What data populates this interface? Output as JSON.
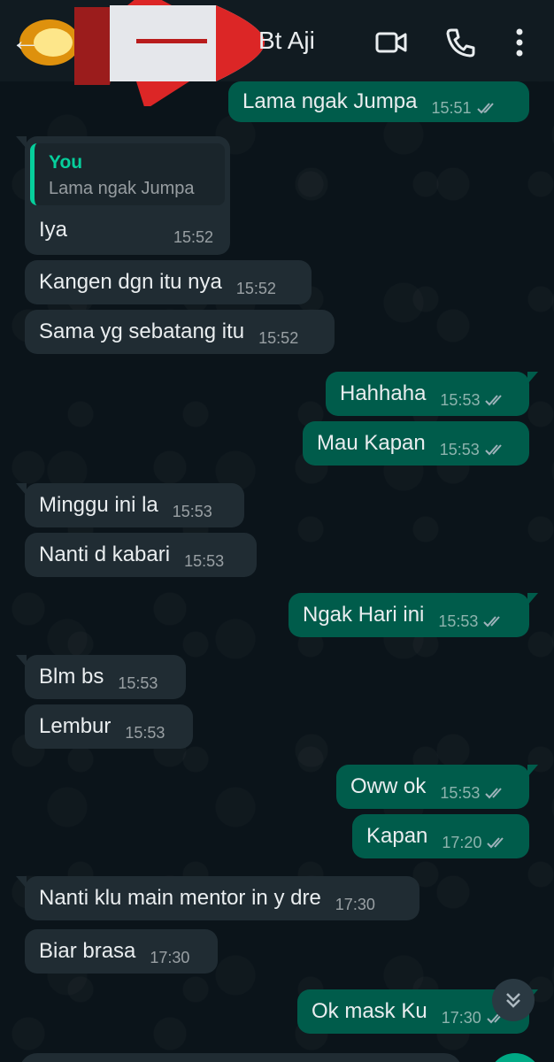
{
  "header": {
    "contact_name": "Bt Aji",
    "icons": [
      "back-arrow-icon",
      "rocket-emoji-icon",
      "video-call-icon",
      "phone-call-icon",
      "more-options-icon"
    ]
  },
  "messages": [
    {
      "dir": "out",
      "text": "Lama ngak Jumpa",
      "time": "15:51",
      "status": "read"
    },
    {
      "dir": "in",
      "quote_author": "You",
      "quote_text": "Lama ngak Jumpa",
      "text": "Iya",
      "time": "15:52"
    },
    {
      "dir": "in",
      "text": "Kangen dgn itu nya",
      "time": "15:52"
    },
    {
      "dir": "in",
      "text": "Sama yg sebatang itu",
      "time": "15:52"
    },
    {
      "dir": "out",
      "text": "Hahhaha",
      "time": "15:53",
      "status": "read"
    },
    {
      "dir": "out",
      "text": "Mau Kapan",
      "time": "15:53",
      "status": "read"
    },
    {
      "dir": "in",
      "text": "Minggu ini la",
      "time": "15:53"
    },
    {
      "dir": "in",
      "text": "Nanti d kabari",
      "time": "15:53"
    },
    {
      "dir": "out",
      "text": "Ngak Hari ini",
      "time": "15:53",
      "status": "read"
    },
    {
      "dir": "in",
      "text": "Blm bs",
      "time": "15:53"
    },
    {
      "dir": "in",
      "text": "Lembur",
      "time": "15:53"
    },
    {
      "dir": "out",
      "text": "Oww ok",
      "time": "15:53",
      "status": "read"
    },
    {
      "dir": "out",
      "text": "Kapan",
      "time": "17:20",
      "status": "read"
    },
    {
      "dir": "in",
      "text": "Nanti klu main mentor in y dre",
      "time": "17:30"
    },
    {
      "dir": "in",
      "text": "Biar brasa",
      "time": "17:30"
    },
    {
      "dir": "out",
      "text": "Ok mask Ku",
      "time": "17:30",
      "status": "read"
    }
  ],
  "colors": {
    "background": "#0b141a",
    "header": "#111b21",
    "incoming_bubble": "#202c33",
    "outgoing_bubble": "#005c4b",
    "accent": "#06cf9c"
  }
}
